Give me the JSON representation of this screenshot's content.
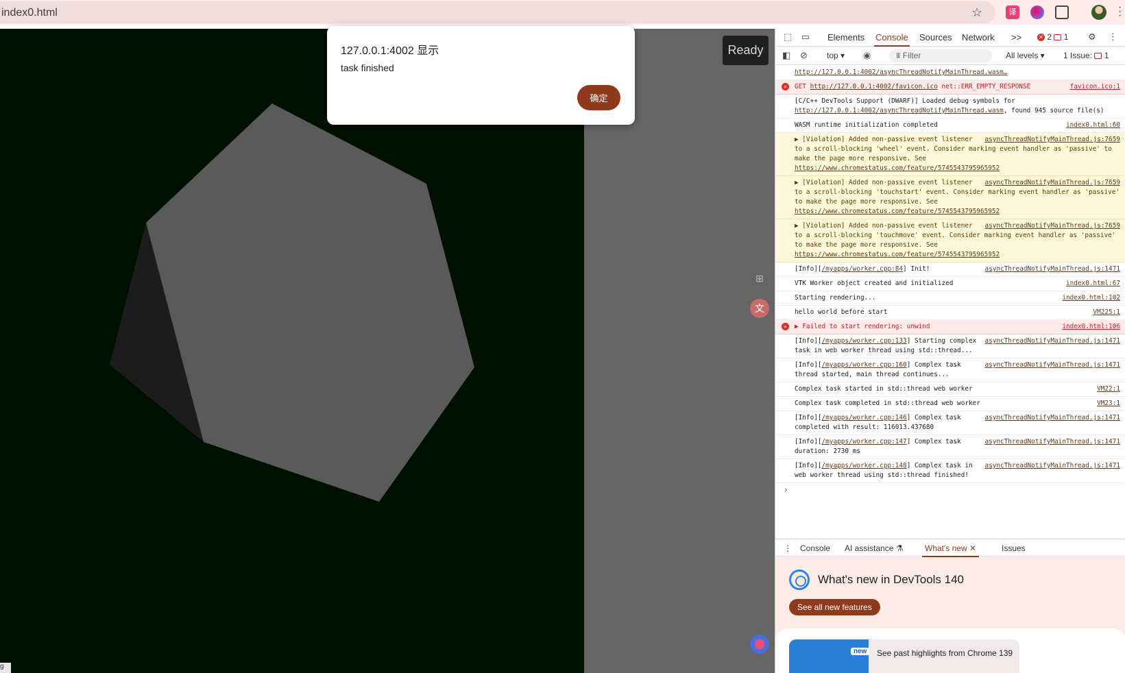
{
  "browser": {
    "tab_title": "index0.html",
    "ext1_label": "译"
  },
  "page": {
    "ready_label": "Ready",
    "bottom_tag": "g"
  },
  "dialog": {
    "title": "127.0.0.1:4002 显示",
    "message": "task finished",
    "ok_label": "确定"
  },
  "devtools": {
    "tabs": [
      "Elements",
      "Console",
      "Sources",
      "Network"
    ],
    "more_tabs": ">>",
    "error_count": "2",
    "message_count": "1",
    "context": "top ▾",
    "filter_placeholder": "Filter",
    "levels": "All levels ▾",
    "issues": "1 Issue:",
    "issues_count": "1",
    "console_rows": [
      {
        "type": "log",
        "text": "",
        "link": "http://127.0.0.1:4002/asyncThreadNotifyMainThread.wasm…",
        "src": ""
      },
      {
        "type": "err",
        "text": "GET ",
        "link": "http://127.0.0.1:4002/favicon.ico",
        "text2": " net::ERR_EMPTY_RESPONSE",
        "src": "favicon.ico:1"
      },
      {
        "type": "log",
        "text": "[C/C++ DevTools Support (DWARF)] Loaded debug symbols for ",
        "link": "http://127.0.0.1:4002/asyncThreadNotifyMainThread.wasm",
        "text2": ", found 945 source file(s)",
        "src": ""
      },
      {
        "type": "log",
        "text": "WASM runtime initialization completed",
        "src": "index0.html:60"
      },
      {
        "type": "warn",
        "text": "▶ [Violation] Added non-passive event listener to a scroll-blocking 'wheel' event. Consider marking event handler as 'passive' to make the page more responsive. See ",
        "link": "https://www.chromestatus.com/feature/5745543795965952",
        "src": "asyncThreadNotifyMainThread.js:7659"
      },
      {
        "type": "warn",
        "text": "▶ [Violation] Added non-passive event listener to a scroll-blocking 'touchstart' event. Consider marking event handler as 'passive' to make the page more responsive. See ",
        "link": "https://www.chromestatus.com/feature/5745543795965952",
        "src": "asyncThreadNotifyMainThread.js:7659"
      },
      {
        "type": "warn",
        "text": "▶ [Violation] Added non-passive event listener to a scroll-blocking 'touchmove' event. Consider marking event handler as 'passive' to make the page more responsive. See ",
        "link": "https://www.chromestatus.com/feature/5745543795965952",
        "src": "asyncThreadNotifyMainThread.js:7659"
      },
      {
        "type": "log",
        "text": "[Info][",
        "link": "/myapps/worker.cpp:84",
        "text2": "] Init!",
        "src": "asyncThreadNotifyMainThread.js:1471"
      },
      {
        "type": "log",
        "text": "VTK Worker object created and initialized",
        "src": "index0.html:67"
      },
      {
        "type": "log",
        "text": "Starting rendering...",
        "src": "index0.html:102"
      },
      {
        "type": "log",
        "text": "hello world before start",
        "src": "VM225:1"
      },
      {
        "type": "err",
        "text": "▶ Failed to start rendering: unwind",
        "src": "index0.html:106"
      },
      {
        "type": "log",
        "text": "[Info][",
        "link": "/myapps/worker.cpp:133",
        "text2": "] Starting complex task in web worker thread using std::thread...",
        "src": "asyncThreadNotifyMainThread.js:1471"
      },
      {
        "type": "log",
        "text": "[Info][",
        "link": "/myapps/worker.cpp:160",
        "text2": "] Complex task thread started, main thread continues...",
        "src": "asyncThreadNotifyMainThread.js:1471"
      },
      {
        "type": "log",
        "text": "Complex task started in std::thread web worker",
        "src": "VM22:1"
      },
      {
        "type": "log",
        "text": "Complex task completed in std::thread web worker",
        "src": "VM23:1"
      },
      {
        "type": "log",
        "text": "[Info][",
        "link": "/myapps/worker.cpp:146",
        "text2": "] Complex task completed with result: 116013.437680",
        "src": "asyncThreadNotifyMainThread.js:1471"
      },
      {
        "type": "log",
        "text": "[Info][",
        "link": "/myapps/worker.cpp:147",
        "text2": "] Complex task duration: 2730 ms",
        "src": "asyncThreadNotifyMainThread.js:1471"
      },
      {
        "type": "log",
        "text": "[Info][",
        "link": "/myapps/worker.cpp:148",
        "text2": "] Complex task in web worker thread using std::thread finished!",
        "src": "asyncThreadNotifyMainThread.js:1471"
      }
    ],
    "prompt_symbol": "›",
    "drawer_tabs": [
      "Console",
      "AI assistance ⚗",
      "What's new ✕",
      "Issues"
    ],
    "whats_new": {
      "title": "What's new in DevTools 140",
      "button": "See all new features",
      "card_badge": "new",
      "card_text": "See past highlights from Chrome 139"
    }
  },
  "colors": {
    "accent": "#8f3a1d",
    "scene_bg": "#001000",
    "polygon_face": "#5a5a5a",
    "polygon_shadow": "#1c1c1c"
  }
}
